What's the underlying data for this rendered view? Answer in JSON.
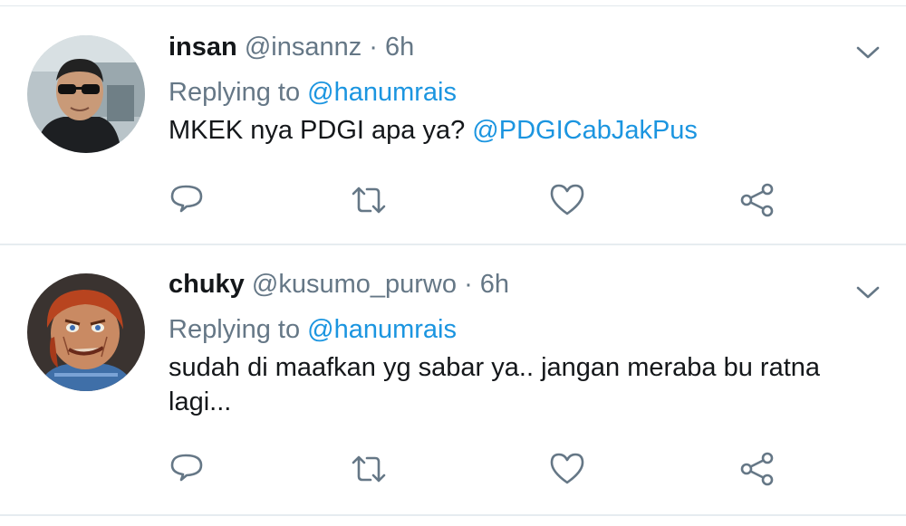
{
  "tweets": [
    {
      "name": "insan",
      "handle": "@insannz",
      "separator": "·",
      "time": "6h",
      "replying_prefix": "Replying to",
      "replying_handle": "@hanumrais",
      "text": "MKEK nya PDGI apa ya? ",
      "text_mention": "@PDGICabJakPus"
    },
    {
      "name": "chuky",
      "handle": "@kusumo_purwo",
      "separator": "·",
      "time": "6h",
      "replying_prefix": "Replying to",
      "replying_handle": "@hanumrais",
      "text": "sudah di maafkan yg sabar ya.. jangan meraba bu ratna lagi...",
      "text_mention": ""
    }
  ],
  "icons": {
    "reply": "reply-icon",
    "retweet": "retweet-icon",
    "like": "heart-icon",
    "share": "share-icon",
    "menu": "chevron-down-icon"
  },
  "colors": {
    "accent": "#1b95e0",
    "secondary_text": "#657786",
    "primary_text": "#14171a",
    "divider": "#e6ecf0"
  }
}
